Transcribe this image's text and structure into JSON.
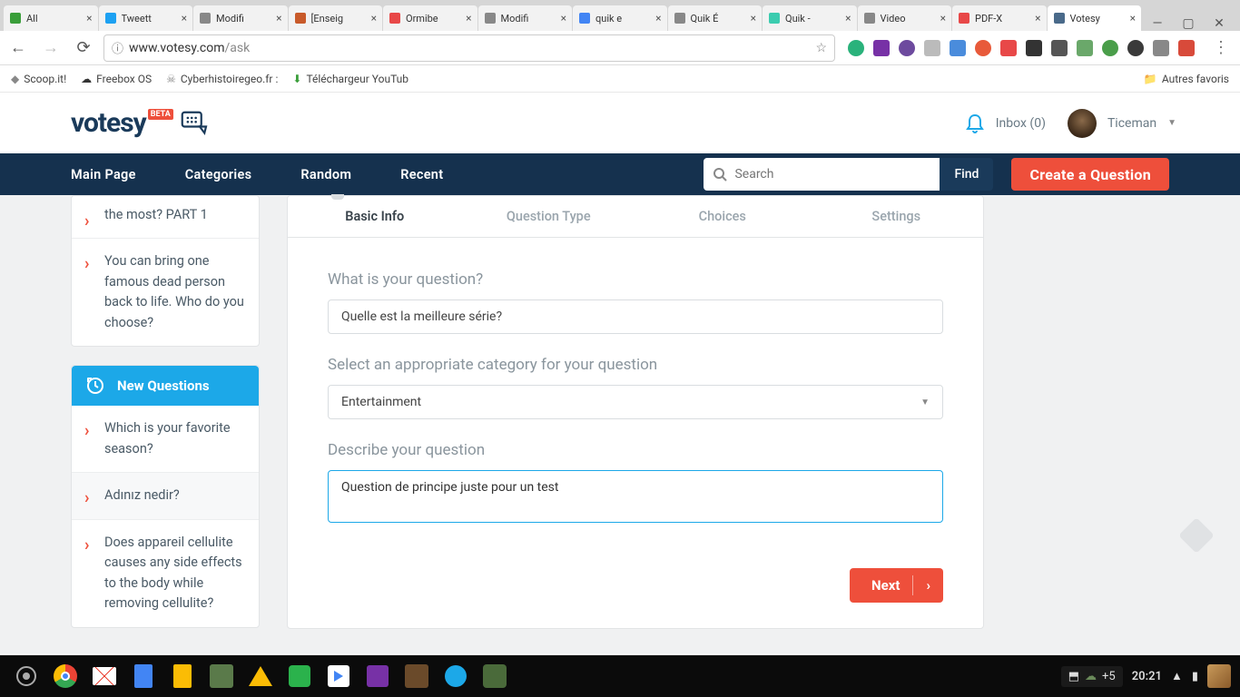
{
  "browser": {
    "tabs": [
      {
        "title": "All",
        "favColor": "#3a9e3a"
      },
      {
        "title": "Tweett",
        "favColor": "#1da1f2"
      },
      {
        "title": "Modifi",
        "favColor": "#888"
      },
      {
        "title": "[Enseig",
        "favColor": "#c85a2a"
      },
      {
        "title": "Ormibe",
        "favColor": "#e84848"
      },
      {
        "title": "Modifi",
        "favColor": "#888"
      },
      {
        "title": "quik e",
        "favColor": "#4285f4"
      },
      {
        "title": "Quik É",
        "favColor": "#888"
      },
      {
        "title": "Quik -",
        "favColor": "#3bccaf"
      },
      {
        "title": "Video",
        "favColor": "#888"
      },
      {
        "title": "PDF-X",
        "favColor": "#e84848"
      },
      {
        "title": "Votesy",
        "favColor": "#4a6a8a",
        "active": true
      }
    ],
    "url_host": "www.votesy.com",
    "url_path": "/ask",
    "bookmarks": [
      {
        "label": "Scoop.it!"
      },
      {
        "label": "Freebox OS"
      },
      {
        "label": "Cyberhistoiregeo.fr :"
      },
      {
        "label": "Téléchargeur YouTub"
      }
    ],
    "other_bookmarks": "Autres favoris"
  },
  "header": {
    "logo": "votesy",
    "beta": "BETA",
    "inbox": "Inbox (0)",
    "user": "Ticeman"
  },
  "nav": {
    "items": [
      "Main Page",
      "Categories",
      "Random",
      "Recent"
    ],
    "search_placeholder": "Search",
    "find": "Find",
    "create": "Create a Question"
  },
  "left": {
    "top_q1": "the most? PART 1",
    "top_q2": "You can bring one famous dead person back to life. Who do you choose?",
    "heading": "New Questions",
    "items": [
      "Which is your favorite season?",
      "Adınız nedir?",
      "Does appareil cellulite causes any side effects to the body while removing cellulite?"
    ]
  },
  "wizard": {
    "tabs": [
      "Basic Info",
      "Question Type",
      "Choices",
      "Settings"
    ],
    "q_label": "What is your question?",
    "q_value": "Quelle est la meilleure série?",
    "cat_label": "Select an appropriate category for your question",
    "cat_value": "Entertainment",
    "desc_label": "Describe your question",
    "desc_value": "Question de principe juste pour un test",
    "next": "Next"
  },
  "taskbar": {
    "count": "+5",
    "time": "20:21"
  }
}
